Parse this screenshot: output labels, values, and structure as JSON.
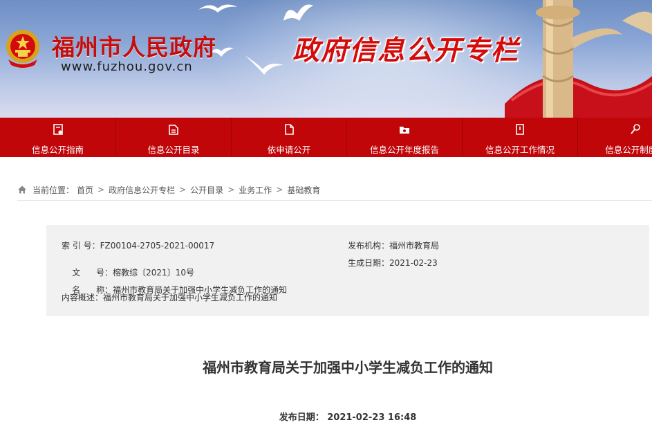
{
  "header": {
    "site_name": "福州市人民政府",
    "site_url": "www.fuzhou.gov.cn",
    "column_title": "政府信息公开专栏"
  },
  "nav": [
    {
      "label": "信息公开指南",
      "icon": "guide-icon"
    },
    {
      "label": "信息公开目录",
      "icon": "catalog-icon"
    },
    {
      "label": "依申请公开",
      "icon": "apply-icon"
    },
    {
      "label": "信息公开年度报告",
      "icon": "report-icon"
    },
    {
      "label": "信息公开工作情况",
      "icon": "work-icon"
    },
    {
      "label": "信息公开制度规",
      "icon": "rules-icon"
    }
  ],
  "breadcrumb": {
    "prefix": "当前位置：",
    "items": [
      "首页",
      "政府信息公开专栏",
      "公开目录",
      "业务工作",
      "基础教育"
    ],
    "separator": ">"
  },
  "info": {
    "index_label": "索 引 号：",
    "index_value": "FZ00104-2705-2021-00017",
    "publisher_label": "发布机构：",
    "publisher_value": "福州市教育局",
    "docno_label": "文      号：",
    "docno_value": "榕教综〔2021〕10号",
    "created_label": "生成日期：",
    "created_value": "2021-02-23",
    "name_label": "名      称：",
    "name_value": "福州市教育局关于加强中小学生减负工作的通知",
    "summary_label": "内容概述：",
    "summary_value": "福州市教育局关于加强中小学生减负工作的通知"
  },
  "article": {
    "title": "福州市教育局关于加强中小学生减负工作的通知",
    "pubdate_label": "发布日期：",
    "pubdate_value": "2021-02-23 16:48"
  },
  "colors": {
    "brand_red": "#c1060a",
    "title_red": "#d40b0b",
    "info_bg": "#f1f1f1"
  }
}
